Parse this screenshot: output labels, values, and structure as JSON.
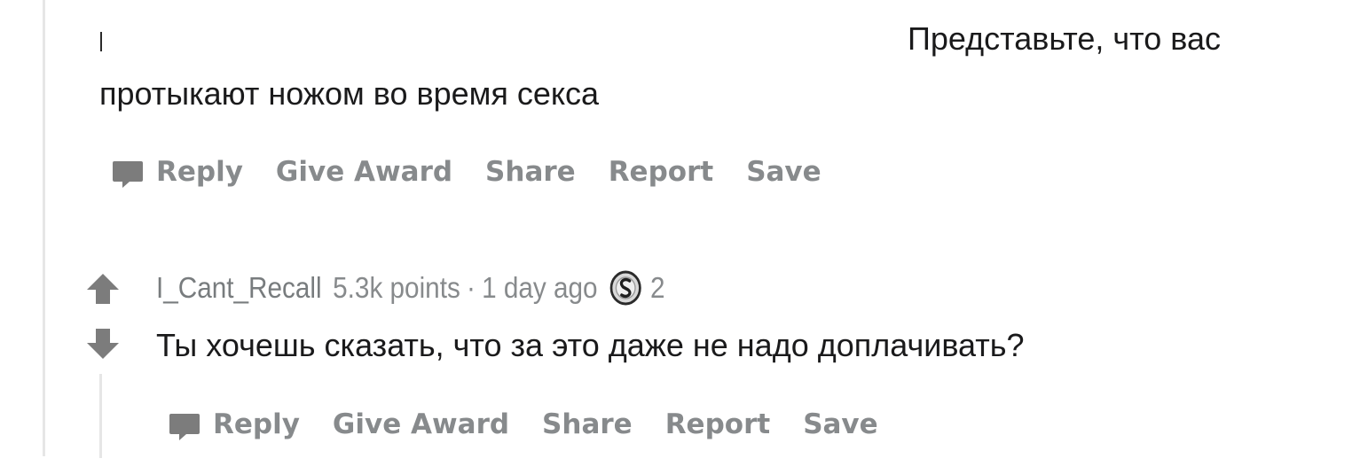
{
  "comment_parent": {
    "body_line1": "Представьте, что вас",
    "body_line2": "протыкают ножом во время секса",
    "actions": {
      "reply": "Reply",
      "give_award": "Give Award",
      "share": "Share",
      "report": "Report",
      "save": "Save"
    }
  },
  "comment_reply": {
    "author": "I_Cant_Recall",
    "points": "5.3k points",
    "separator": "·",
    "age": "1 day ago",
    "award_icon": "silver-award-icon",
    "award_count": "2",
    "body": "Ты хочешь сказать, что за это даже не надо доплачивать?",
    "actions": {
      "reply": "Reply",
      "give_award": "Give Award",
      "share": "Share",
      "report": "Report",
      "save": "Save"
    }
  },
  "icons": {
    "reply": "comment-bubble-icon",
    "upvote": "upvote-arrow-icon",
    "downvote": "downvote-arrow-icon"
  },
  "colors": {
    "text": "#1a1a1b",
    "muted": "#878a8c",
    "icon": "#7c7c7c",
    "thread_line": "#e6e6e6"
  }
}
